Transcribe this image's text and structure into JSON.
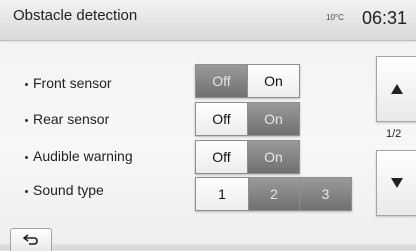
{
  "header": {
    "title": "Obstacle detection",
    "temperature": "10°C",
    "time": "06:31"
  },
  "settings": [
    {
      "label": "Front sensor",
      "options": [
        "Off",
        "On"
      ],
      "selected": "On"
    },
    {
      "label": "Rear sensor",
      "options": [
        "Off",
        "On"
      ],
      "selected": "Off"
    },
    {
      "label": "Audible warning",
      "options": [
        "Off",
        "On"
      ],
      "selected": "Off"
    },
    {
      "label": "Sound type",
      "options": [
        "1",
        "2",
        "3"
      ],
      "selected": "1"
    }
  ],
  "pagination": {
    "indicator": "1/2"
  },
  "icons": {
    "up": "arrow-up-icon",
    "down": "arrow-down-icon",
    "back": "back-arrow-icon"
  }
}
